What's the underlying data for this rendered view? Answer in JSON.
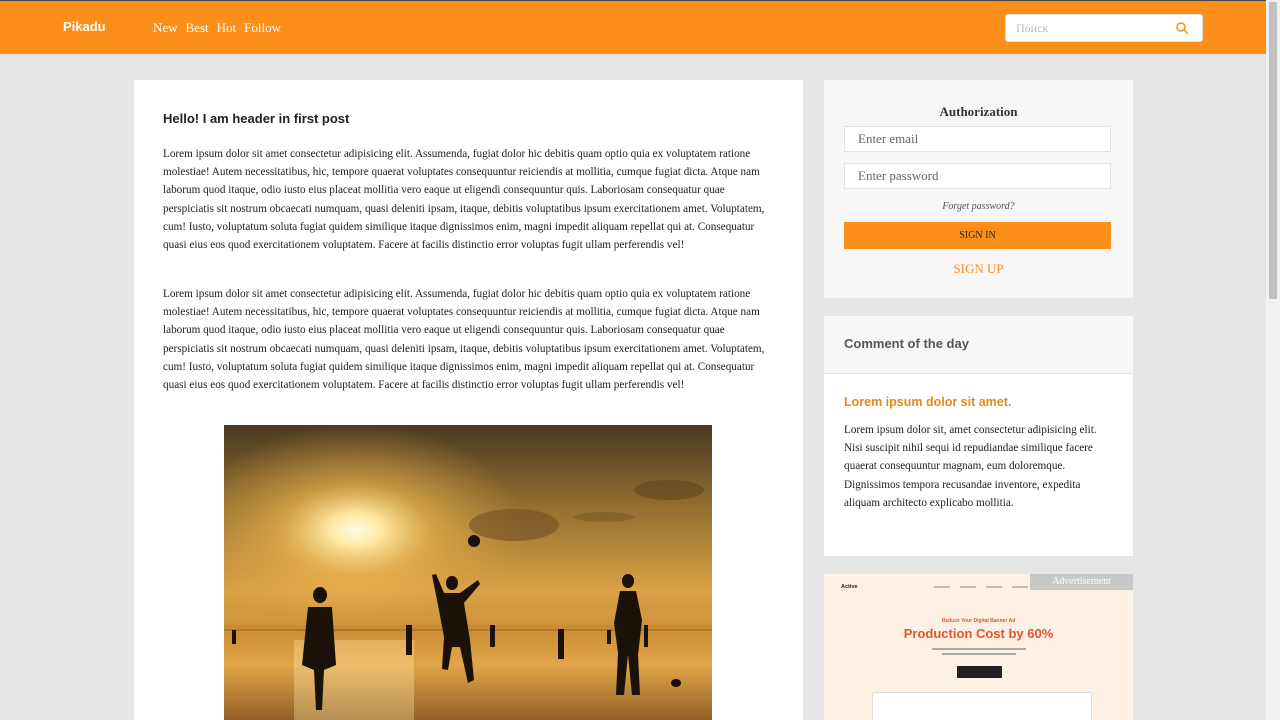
{
  "header": {
    "logo": "Pikadu",
    "nav": [
      "New",
      "Best",
      "Hot",
      "Follow"
    ],
    "search_placeholder": "Поиск"
  },
  "post": {
    "title": "Hello! I am header in first post",
    "paragraphs": [
      "Lorem ipsum dolor sit amet consectetur adipisicing elit. Assumenda, fugiat dolor hic debitis quam optio quia ex voluptatem ratione molestiae! Autem necessitatibus, hic, tempore quaerat voluptates consequuntur reiciendis at mollitia, cumque fugiat dicta. Atque nam laborum quod itaque, odio iusto eius placeat mollitia vero eaque ut eligendi consequuntur quis. Laboriosam consequatur quae perspiciatis sit nostrum obcaecati numquam, quasi deleniti ipsam, itaque, debitis voluptatibus ipsum exercitationem amet. Voluptatem, cum! Iusto, voluptatum soluta fugiat quidem similique itaque dignissimos enim, magni impedit aliquam repellat qui at. Consequatur quasi eius eos quod exercitationem voluptatem. Facere at facilis distinctio error voluptas fugit ullam perferendis vel!",
      "Lorem ipsum dolor sit amet consectetur adipisicing elit. Assumenda, fugiat dolor hic debitis quam optio quia ex voluptatem ratione molestiae! Autem necessitatibus, hic, tempore quaerat voluptates consequuntur reiciendis at mollitia, cumque fugiat dicta. Atque nam laborum quod itaque, odio iusto eius placeat mollitia vero eaque ut eligendi consequuntur quis. Laboriosam consequatur quae perspiciatis sit nostrum obcaecati numquam, quasi deleniti ipsam, itaque, debitis voluptatibus ipsum exercitationem amet. Voluptatem, cum! Iusto, voluptatum soluta fugiat quidem similique itaque dignissimos enim, magni impedit aliquam repellat qui at. Consequatur quasi eius eos quod exercitationem voluptatem. Facere at facilis distinctio error voluptas fugit ullam perferendis vel!"
    ]
  },
  "auth": {
    "title": "Authorization",
    "email_placeholder": "Enter email",
    "password_placeholder": "Enter password",
    "forgot": "Forget password?",
    "signin": "SIGN IN",
    "signup": "SIGN UP"
  },
  "comment_of_day": {
    "heading": "Comment of the day",
    "title": "Lorem ipsum dolor sit amet.",
    "text": "Lorem ipsum dolor sit, amet consectetur adipisicing elit. Nisi suscipit nihil sequi id repudiandae similique facere quaerat consequuntur magnam, eum doloremque. Dignissimos tempora recusandae inventore, expedita aliquam architecto explicabo mollitia."
  },
  "ad": {
    "badge": "Advertisement",
    "brand": "Active",
    "kicker": "Reduce Your Digital Banner Ad",
    "headline": "Production Cost by 60%"
  },
  "colors": {
    "accent": "#fb8f1a",
    "comment_title": "#e38a17",
    "ad_headline": "#e5532b"
  },
  "icons": {
    "search": "search-icon"
  }
}
